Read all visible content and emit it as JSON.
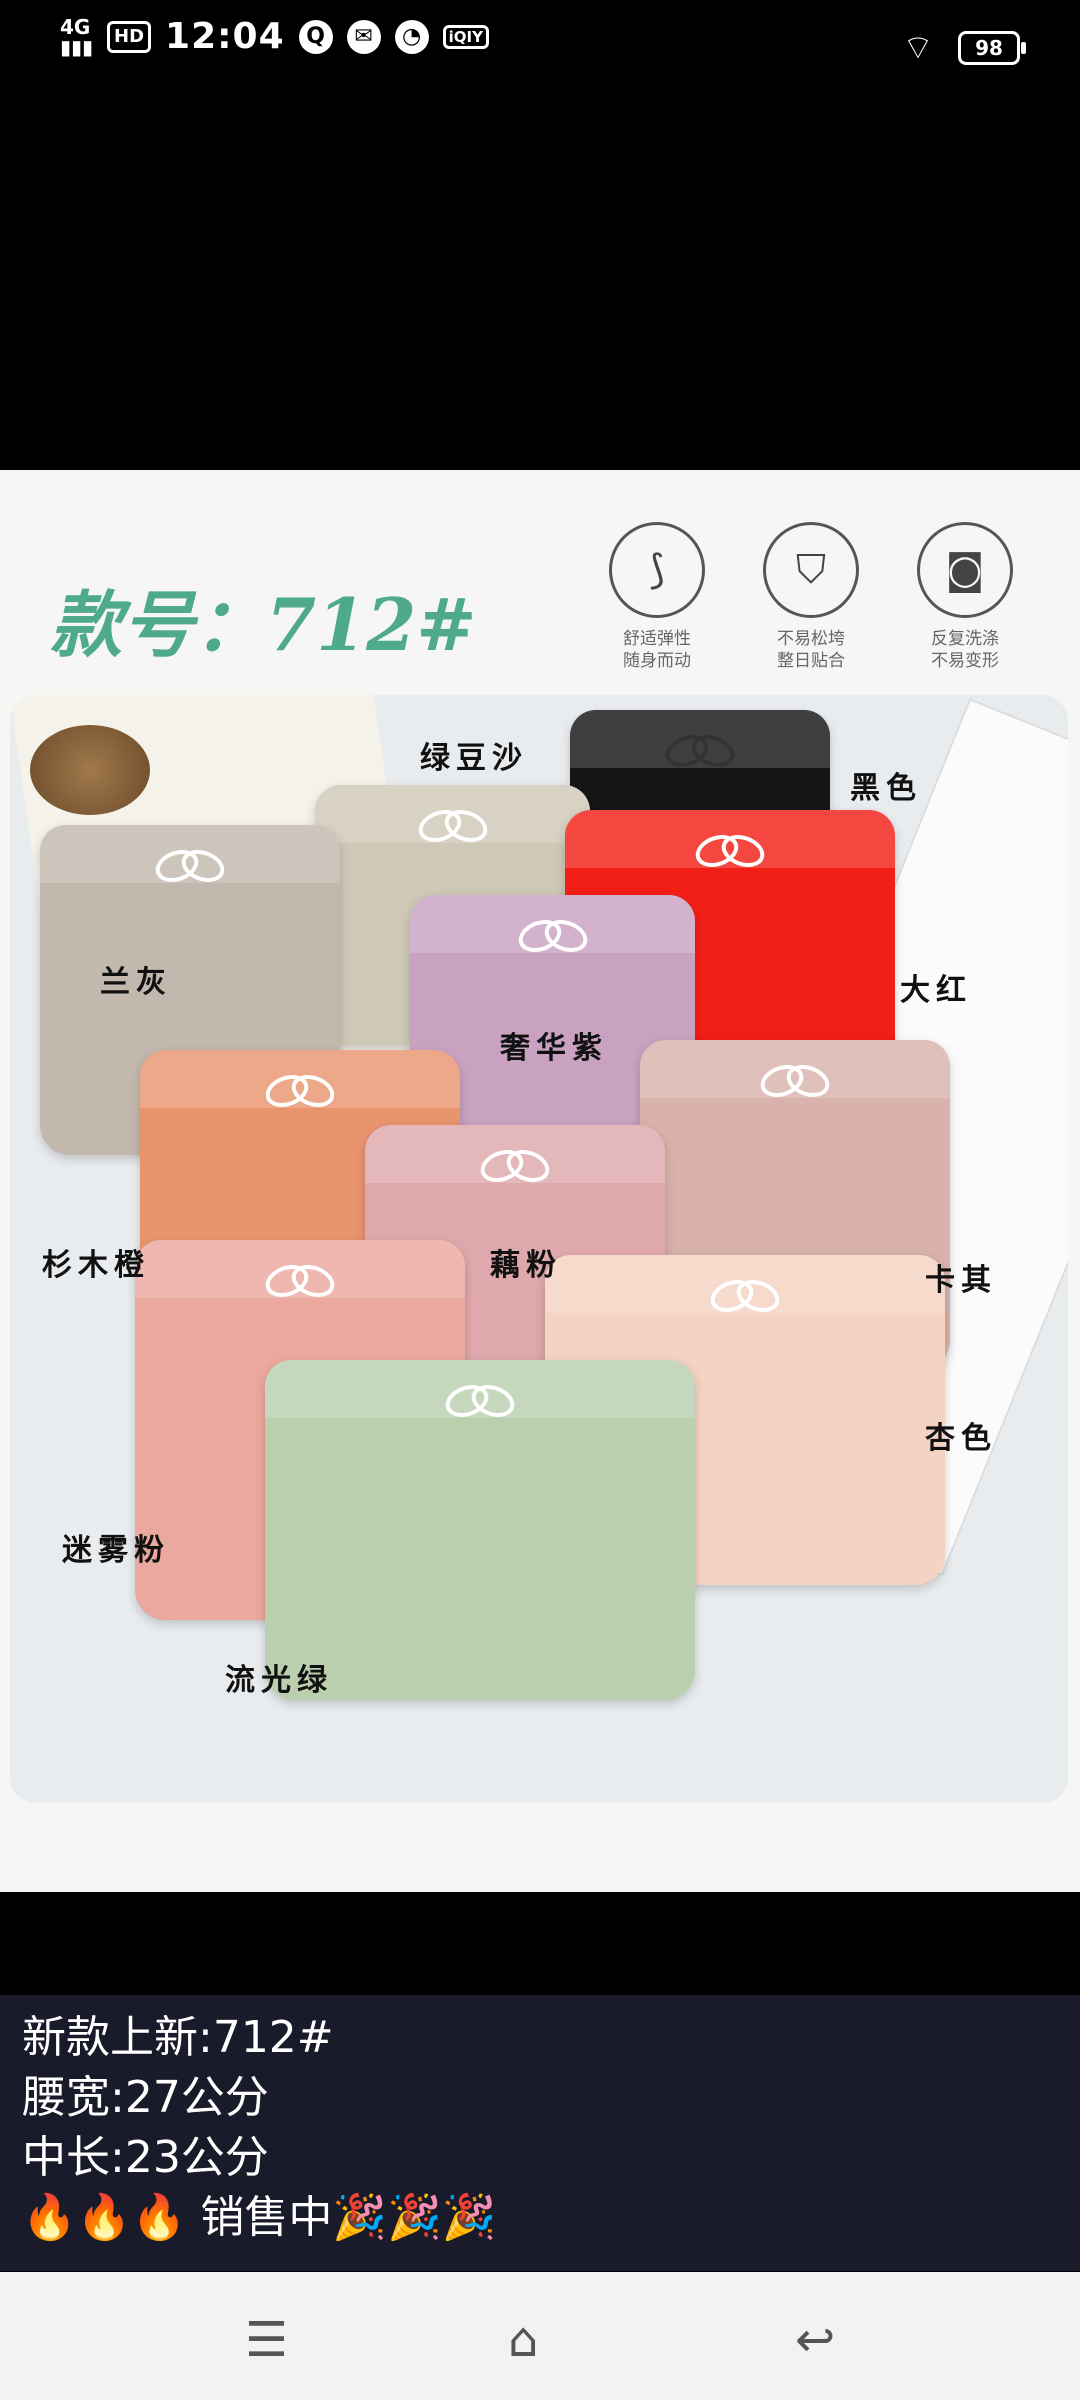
{
  "status_bar": {
    "network": "4G",
    "hd": "HD",
    "time": "12:04",
    "iqiyi": "iQIY",
    "battery": "98"
  },
  "product": {
    "model_label": "款号：712#",
    "features": [
      {
        "icon": "elasticity-icon",
        "line1": "舒适弹性",
        "line2": "随身而动"
      },
      {
        "icon": "shirt-fit-icon",
        "line1": "不易松垮",
        "line2": "整日贴合"
      },
      {
        "icon": "washing-machine-icon",
        "line1": "反复洗涤",
        "line2": "不易变形"
      }
    ],
    "colors": [
      {
        "name": "绿豆沙",
        "hex": "#cfc8b6"
      },
      {
        "name": "黑色",
        "hex": "#151515"
      },
      {
        "name": "兰灰",
        "hex": "#c2b8ae"
      },
      {
        "name": "大红",
        "hex": "#f21f17"
      },
      {
        "name": "奢华紫",
        "hex": "#c9a2c1"
      },
      {
        "name": "杉木橙",
        "hex": "#e8956e"
      },
      {
        "name": "藕粉",
        "hex": "#dfa8ac"
      },
      {
        "name": "卡其",
        "hex": "#d8b2ab"
      },
      {
        "name": "杏色",
        "hex": "#f4d3c3"
      },
      {
        "name": "迷雾粉",
        "hex": "#eba89e"
      },
      {
        "name": "流光绿",
        "hex": "#b9cfae"
      }
    ]
  },
  "caption": {
    "line1": "新款上新:712#",
    "line2": "腰宽:27公分",
    "line3": "中长:23公分",
    "line4": "🔥🔥🔥 销售中🎉🎉🎉"
  },
  "nav": {
    "menu_icon": "☰",
    "home_icon": "⌂",
    "back_icon": "↩"
  }
}
